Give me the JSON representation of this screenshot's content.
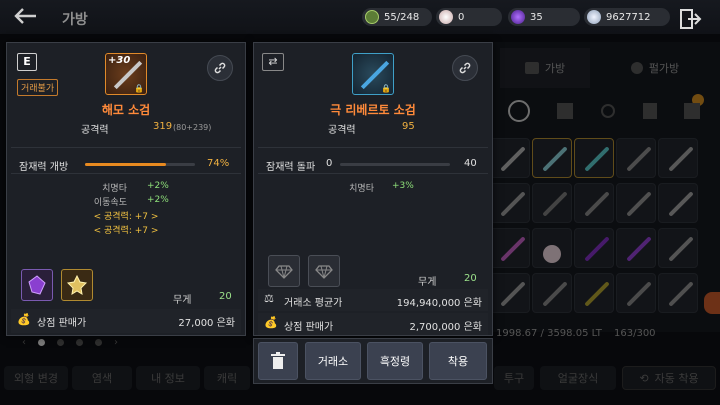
{
  "header": {
    "title": "가방",
    "currencies": [
      {
        "icon": "bag-capacity-icon",
        "value": "55/248",
        "color": "#7fa64a"
      },
      {
        "icon": "pearl-icon",
        "value": "0",
        "color": "#e6d8d8"
      },
      {
        "icon": "purple-gem-icon",
        "value": "35",
        "color": "#7a3fd0"
      },
      {
        "icon": "silver-coin-icon",
        "value": "9627712",
        "color": "#b8c4d0"
      }
    ]
  },
  "background": {
    "tabs": [
      "가방",
      "펄가방"
    ],
    "weight": "1998.67 / 3598.05 LT",
    "slots": "163/300",
    "bottom_buttons": [
      "외형 변경",
      "염색",
      "내 정보",
      "캐릭",
      "투구",
      "얼굴장식",
      "자동 착용"
    ]
  },
  "left_card": {
    "grade": "E",
    "trade_status": "거래불가",
    "enhance": "+30",
    "name": "해모 소검",
    "attack_label": "공격력",
    "attack_value": "319",
    "attack_detail": "(80+239)",
    "potential_label": "잠재력 개방",
    "potential_value": "74%",
    "potential_fraction": 0.74,
    "stats": [
      {
        "label": "치명타",
        "value": "+2%"
      },
      {
        "label": "이동속도",
        "value": "+2%"
      }
    ],
    "options": [
      "< 공격력: +7 >",
      "< 공격력: +7 >"
    ],
    "weight_label": "무게",
    "weight_value": "20",
    "sell_label": "상점 판매가",
    "sell_value": "27,000 은화"
  },
  "right_card": {
    "name": "극 리베르토 소검",
    "attack_label": "공격력",
    "attack_value": "95",
    "breakthrough_label": "잠재력 돌파",
    "breakthrough_min": "0",
    "breakthrough_max": "40",
    "breakthrough_fraction": 0,
    "stats": [
      {
        "label": "치명타",
        "value": "+3%"
      }
    ],
    "weight_label": "무게",
    "weight_value": "20",
    "market_label": "거래소 평균가",
    "market_value": "194,940,000 은화",
    "sell_label": "상점 판매가",
    "sell_value": "2,700,000 은화"
  },
  "actions": {
    "exchange": "거래소",
    "black_spirit": "흑정령",
    "equip": "착용"
  }
}
